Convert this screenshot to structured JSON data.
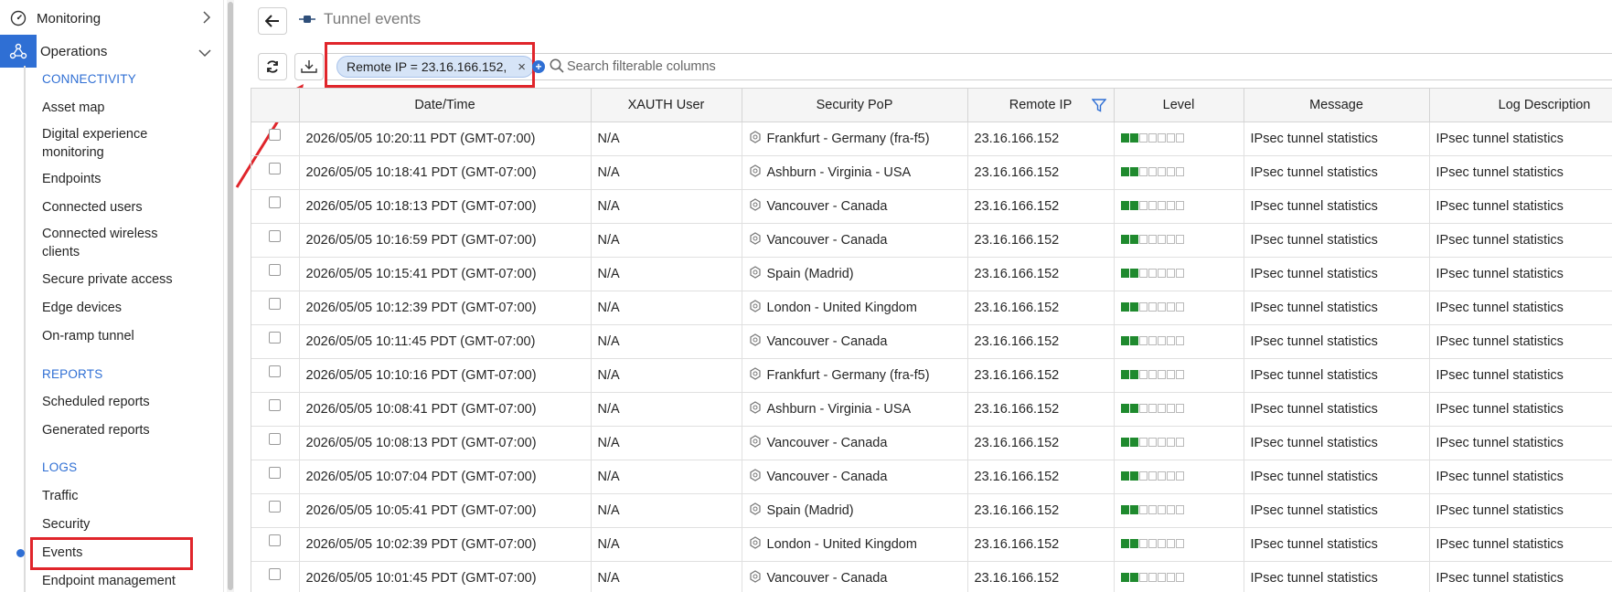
{
  "sidebar": {
    "monitoring_label": "Monitoring",
    "operations_label": "Operations",
    "sections": [
      {
        "title": "CONNECTIVITY"
      },
      {
        "title": "REPORTS"
      },
      {
        "title": "LOGS"
      }
    ],
    "items": [
      {
        "label": "Asset map"
      },
      {
        "label": "Digital experience monitoring"
      },
      {
        "label": "Endpoints"
      },
      {
        "label": "Connected users"
      },
      {
        "label": "Connected wireless clients"
      },
      {
        "label": "Secure private access"
      },
      {
        "label": "Edge devices"
      },
      {
        "label": "On-ramp tunnel"
      },
      {
        "label": "Scheduled reports"
      },
      {
        "label": "Generated reports"
      },
      {
        "label": "Traffic"
      },
      {
        "label": "Security"
      },
      {
        "label": "Events"
      },
      {
        "label": "Endpoint management"
      }
    ]
  },
  "header": {
    "title": "Tunnel events"
  },
  "toolbar": {
    "filter_chip": "Remote IP = 23.16.166.152,",
    "chip_remove": "×",
    "add_filter": "+",
    "search_placeholder": "Search filterable columns"
  },
  "colors": {
    "accent": "#2f6fd4",
    "highlight": "#e0252b",
    "level_on": "#1f8a2e"
  },
  "table": {
    "columns": [
      "",
      "Date/Time",
      "XAUTH User",
      "Security PoP",
      "Remote IP",
      "Level",
      "Message",
      "Log Description"
    ],
    "level_filled": 2,
    "level_total": 7,
    "rows": [
      {
        "datetime": "2026/05/05 10:20:11 PDT (GMT-07:00)",
        "user": "N/A",
        "pop": "Frankfurt - Germany (fra-f5)",
        "ip": "23.16.166.152",
        "message": "IPsec tunnel statistics",
        "description": "IPsec tunnel statistics"
      },
      {
        "datetime": "2026/05/05 10:18:41 PDT (GMT-07:00)",
        "user": "N/A",
        "pop": "Ashburn - Virginia - USA",
        "ip": "23.16.166.152",
        "message": "IPsec tunnel statistics",
        "description": "IPsec tunnel statistics"
      },
      {
        "datetime": "2026/05/05 10:18:13 PDT (GMT-07:00)",
        "user": "N/A",
        "pop": "Vancouver - Canada",
        "ip": "23.16.166.152",
        "message": "IPsec tunnel statistics",
        "description": "IPsec tunnel statistics"
      },
      {
        "datetime": "2026/05/05 10:16:59 PDT (GMT-07:00)",
        "user": "N/A",
        "pop": "Vancouver - Canada",
        "ip": "23.16.166.152",
        "message": "IPsec tunnel statistics",
        "description": "IPsec tunnel statistics"
      },
      {
        "datetime": "2026/05/05 10:15:41 PDT (GMT-07:00)",
        "user": "N/A",
        "pop": "Spain (Madrid)",
        "ip": "23.16.166.152",
        "message": "IPsec tunnel statistics",
        "description": "IPsec tunnel statistics"
      },
      {
        "datetime": "2026/05/05 10:12:39 PDT (GMT-07:00)",
        "user": "N/A",
        "pop": "London - United Kingdom",
        "ip": "23.16.166.152",
        "message": "IPsec tunnel statistics",
        "description": "IPsec tunnel statistics"
      },
      {
        "datetime": "2026/05/05 10:11:45 PDT (GMT-07:00)",
        "user": "N/A",
        "pop": "Vancouver - Canada",
        "ip": "23.16.166.152",
        "message": "IPsec tunnel statistics",
        "description": "IPsec tunnel statistics"
      },
      {
        "datetime": "2026/05/05 10:10:16 PDT (GMT-07:00)",
        "user": "N/A",
        "pop": "Frankfurt - Germany (fra-f5)",
        "ip": "23.16.166.152",
        "message": "IPsec tunnel statistics",
        "description": "IPsec tunnel statistics"
      },
      {
        "datetime": "2026/05/05 10:08:41 PDT (GMT-07:00)",
        "user": "N/A",
        "pop": "Ashburn - Virginia - USA",
        "ip": "23.16.166.152",
        "message": "IPsec tunnel statistics",
        "description": "IPsec tunnel statistics"
      },
      {
        "datetime": "2026/05/05 10:08:13 PDT (GMT-07:00)",
        "user": "N/A",
        "pop": "Vancouver - Canada",
        "ip": "23.16.166.152",
        "message": "IPsec tunnel statistics",
        "description": "IPsec tunnel statistics"
      },
      {
        "datetime": "2026/05/05 10:07:04 PDT (GMT-07:00)",
        "user": "N/A",
        "pop": "Vancouver - Canada",
        "ip": "23.16.166.152",
        "message": "IPsec tunnel statistics",
        "description": "IPsec tunnel statistics"
      },
      {
        "datetime": "2026/05/05 10:05:41 PDT (GMT-07:00)",
        "user": "N/A",
        "pop": "Spain (Madrid)",
        "ip": "23.16.166.152",
        "message": "IPsec tunnel statistics",
        "description": "IPsec tunnel statistics"
      },
      {
        "datetime": "2026/05/05 10:02:39 PDT (GMT-07:00)",
        "user": "N/A",
        "pop": "London - United Kingdom",
        "ip": "23.16.166.152",
        "message": "IPsec tunnel statistics",
        "description": "IPsec tunnel statistics"
      },
      {
        "datetime": "2026/05/05 10:01:45 PDT (GMT-07:00)",
        "user": "N/A",
        "pop": "Vancouver - Canada",
        "ip": "23.16.166.152",
        "message": "IPsec tunnel statistics",
        "description": "IPsec tunnel statistics"
      }
    ]
  }
}
